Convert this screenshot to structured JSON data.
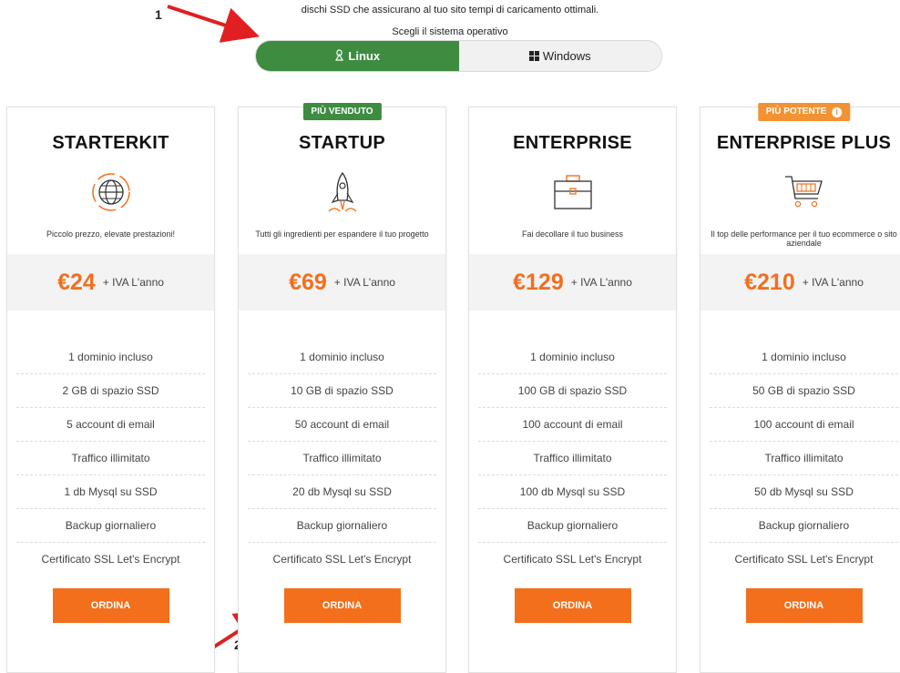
{
  "intro_text": "dischi SSD che assicurano al tuo sito tempi di caricamento ottimali.",
  "os_selector": {
    "label": "Scegli il sistema operativo",
    "options": [
      {
        "label": "Linux",
        "icon": "linux-icon",
        "active": true
      },
      {
        "label": "Windows",
        "icon": "windows-icon",
        "active": false
      }
    ]
  },
  "plans": [
    {
      "name": "STARTERKIT",
      "badge": "",
      "icon": "globe-icon",
      "tagline": "Piccolo prezzo, elevate prestazioni!",
      "price": "€24",
      "price_suffix": "+ IVA L'anno",
      "features": [
        "1 dominio incluso",
        "2 GB di spazio SSD",
        "5 account di email",
        "Traffico illimitato",
        "1 db Mysql su SSD",
        "Backup giornaliero",
        "Certificato SSL Let's Encrypt"
      ],
      "button": "ORDINA"
    },
    {
      "name": "STARTUP",
      "badge": "PIÙ VENDUTO",
      "icon": "rocket-icon",
      "tagline": "Tutti gli ingredienti per espandere il tuo progetto",
      "price": "€69",
      "price_suffix": "+ IVA L'anno",
      "features": [
        "1 dominio incluso",
        "10 GB di spazio SSD",
        "50 account di email",
        "Traffico illimitato",
        "20 db Mysql su SSD",
        "Backup giornaliero",
        "Certificato SSL Let's Encrypt"
      ],
      "button": "ORDINA"
    },
    {
      "name": "ENTERPRISE",
      "badge": "",
      "icon": "briefcase-icon",
      "tagline": "Fai decollare il tuo business",
      "price": "€129",
      "price_suffix": "+ IVA L'anno",
      "features": [
        "1 dominio incluso",
        "100 GB di spazio SSD",
        "100 account di email",
        "Traffico illimitato",
        "100 db Mysql su SSD",
        "Backup giornaliero",
        "Certificato SSL Let's Encrypt"
      ],
      "button": "ORDINA"
    },
    {
      "name": "ENTERPRISE PLUS",
      "badge": "PIÙ POTENTE",
      "icon": "cart-icon",
      "tagline": "Il top delle performance per il tuo ecommerce o sito aziendale",
      "price": "€210",
      "price_suffix": "+ IVA L'anno",
      "features": [
        "1 dominio incluso",
        "50 GB di spazio SSD",
        "100 account di email",
        "Traffico illimitato",
        "50 db Mysql su SSD",
        "Backup giornaliero",
        "Certificato SSL Let's Encrypt"
      ],
      "button": "ORDINA"
    }
  ],
  "annotations": [
    "1",
    "2"
  ],
  "colors": {
    "accent": "#f36f1c",
    "green": "#3d8c40",
    "badge_orange": "#f39232"
  }
}
